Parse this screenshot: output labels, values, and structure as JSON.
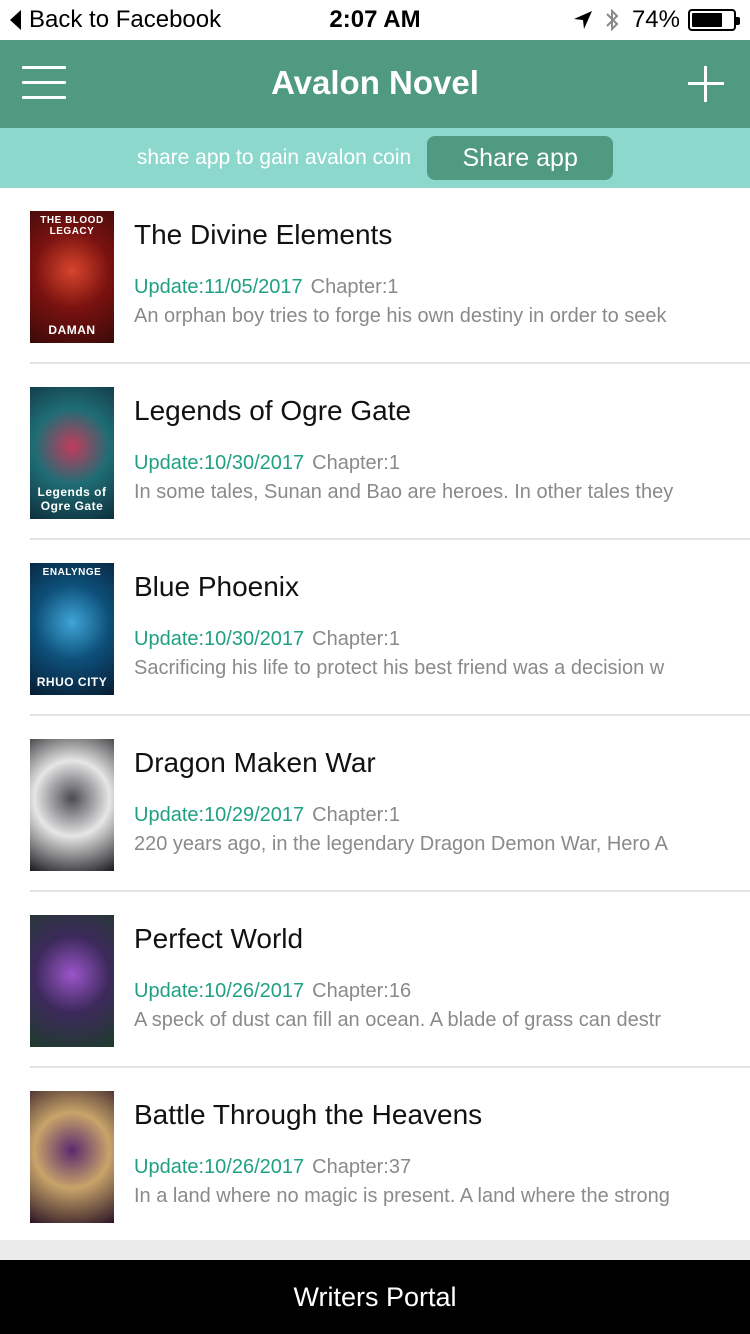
{
  "status_bar": {
    "back_label": "Back to Facebook",
    "time": "2:07 AM",
    "battery_text": "74%",
    "battery_level": 0.74,
    "icons": [
      "location-arrow-icon",
      "bluetooth-icon",
      "battery-icon"
    ]
  },
  "navbar": {
    "title": "Avalon Novel",
    "menu_icon": "hamburger-menu-icon",
    "add_icon": "plus-icon"
  },
  "share": {
    "text": "share app to gain avalon coin",
    "button_label": "Share app"
  },
  "novels": [
    {
      "title": "The Divine Elements",
      "update": "Update:11/05/2017",
      "chapter": "Chapter:1",
      "description": "An orphan boy tries to forge his own destiny in order to seek",
      "cover_text_top": "THE BLOOD LEGACY",
      "cover_text_bottom": "DAMAN",
      "cover_colors": [
        "#7a1210",
        "#d8452c",
        "#3a0a08"
      ]
    },
    {
      "title": "Legends of Ogre Gate",
      "update": "Update:10/30/2017",
      "chapter": "Chapter:1",
      "description": "In some tales, Sunan and Bao are heroes. In other tales they",
      "cover_text_top": "",
      "cover_text_bottom": "Legends of Ogre Gate",
      "cover_colors": [
        "#1f6d74",
        "#c23b5c",
        "#0e2f3d"
      ]
    },
    {
      "title": "Blue Phoenix",
      "update": "Update:10/30/2017",
      "chapter": "Chapter:1",
      "description": "Sacrificing his life to protect his best friend was a decision w",
      "cover_text_top": "ENALYNGE",
      "cover_text_bottom": "RHUO CITY",
      "cover_colors": [
        "#0d4f79",
        "#3fa5d6",
        "#071d33"
      ]
    },
    {
      "title": "Dragon Maken War",
      "update": "Update:10/29/2017",
      "chapter": "Chapter:1",
      "description": "220 years ago, in the legendary Dragon Demon War, Hero A",
      "cover_text_top": "",
      "cover_text_bottom": "",
      "cover_colors": [
        "#e6e6e6",
        "#4a4a52",
        "#1a1a1e"
      ]
    },
    {
      "title": "Perfect World",
      "update": "Update:10/26/2017",
      "chapter": "Chapter:16",
      "description": "A speck of dust can fill an ocean. A blade of grass can destr",
      "cover_text_top": "",
      "cover_text_bottom": "",
      "cover_colors": [
        "#3d2a5c",
        "#9b55c9",
        "#1e3b2c"
      ]
    },
    {
      "title": "Battle Through the Heavens",
      "update": "Update:10/26/2017",
      "chapter": "Chapter:37",
      "description": "In a land where no magic is present. A land where the strong",
      "cover_text_top": "",
      "cover_text_bottom": "",
      "cover_colors": [
        "#c8a46a",
        "#5b2a6e",
        "#2a1424"
      ]
    }
  ],
  "footer": {
    "label": "Writers Portal"
  }
}
